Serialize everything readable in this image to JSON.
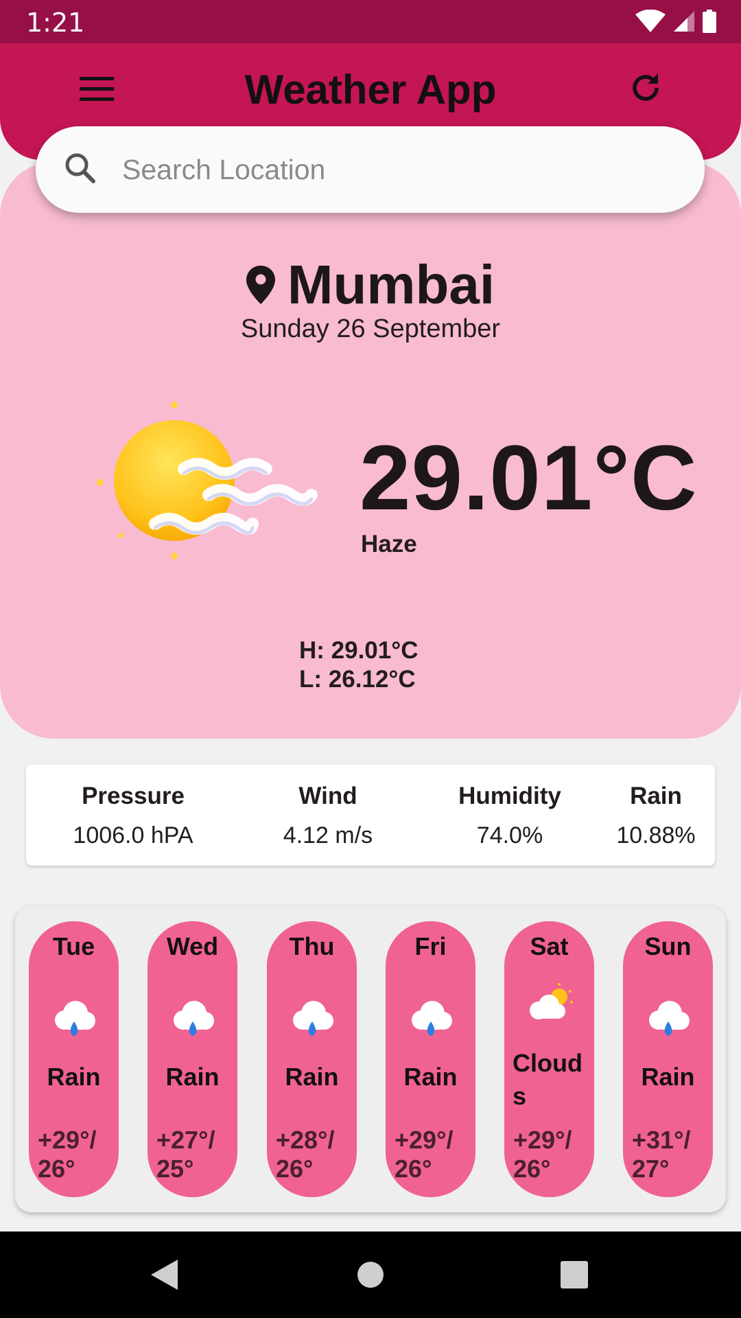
{
  "status_bar": {
    "time": "1:21"
  },
  "header": {
    "title": "Weather App"
  },
  "search": {
    "placeholder": "Search Location",
    "value": ""
  },
  "current": {
    "location": "Mumbai",
    "date": "Sunday 26 September",
    "temperature": "29.01°C",
    "condition": "Haze",
    "high": "H: 29.01°C",
    "low": "L: 26.12°C",
    "icon": "haze-icon"
  },
  "stats": [
    {
      "label": "Pressure",
      "value": "1006.0 hPA"
    },
    {
      "label": "Wind",
      "value": "4.12 m/s"
    },
    {
      "label": "Humidity",
      "value": "74.0%"
    },
    {
      "label": "Rain",
      "value": "10.88%"
    }
  ],
  "forecast": [
    {
      "day": "Tue",
      "condition": "Rain",
      "temp": "+29°/ 26°",
      "icon": "rain-icon"
    },
    {
      "day": "Wed",
      "condition": "Rain",
      "temp": "+27°/ 25°",
      "icon": "rain-icon"
    },
    {
      "day": "Thu",
      "condition": "Rain",
      "temp": "+28°/ 26°",
      "icon": "rain-icon"
    },
    {
      "day": "Fri",
      "condition": "Rain",
      "temp": "+29°/ 26°",
      "icon": "rain-icon"
    },
    {
      "day": "Sat",
      "condition": "Clouds",
      "temp": "+29°/ 26°",
      "icon": "cloud-sun-icon"
    },
    {
      "day": "Sun",
      "condition": "Rain",
      "temp": "+31°/ 27°",
      "icon": "rain-icon"
    }
  ],
  "colors": {
    "status_bar": "#960f46",
    "header": "#c41555",
    "hero_card": "#f8bbd0",
    "forecast_pill": "#f06292"
  }
}
